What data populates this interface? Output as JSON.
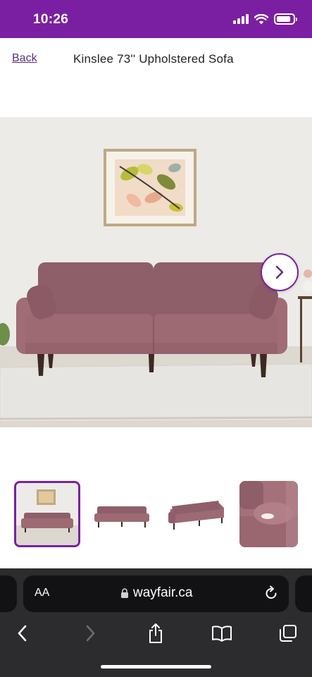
{
  "status": {
    "time": "10:26",
    "battery_level": 0.85
  },
  "header": {
    "back_label": "Back",
    "title": "Kinslee 73'' Upholstered Sofa"
  },
  "gallery": {
    "selected_index": 0,
    "thumbnails": [
      "front view in room",
      "front view",
      "side angle view",
      "fabric and arm close-up"
    ]
  },
  "browser": {
    "text_size_label": "AA",
    "url": "wayfair.ca"
  },
  "colors": {
    "brand_purple": "#7b1fa2",
    "sofa": "#9a6a74",
    "toolbar_bg": "#2c2c2e"
  }
}
